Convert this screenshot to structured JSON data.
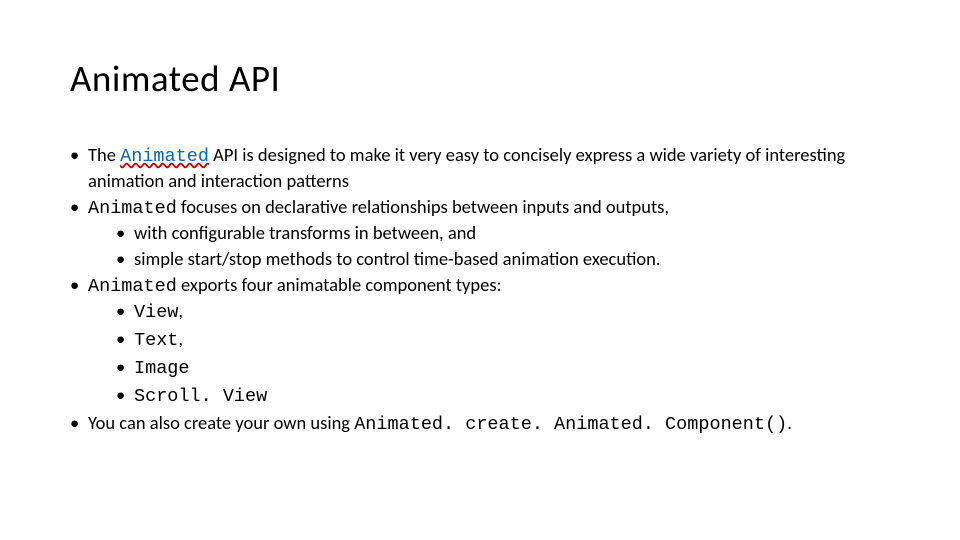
{
  "title": "Animated API",
  "content": {
    "b1_pre": "The ",
    "b1_link": "Animated",
    "b1_post": " API is designed to make it very easy to concisely express a wide variety of interesting animation and interaction patterns",
    "b2_code": "Animated",
    "b2_text": " focuses on declarative relationships between inputs and outputs,",
    "b2_sub1": "with configurable transforms in between, and",
    "b2_sub2": "simple start/stop methods to control time-based animation execution.",
    "b3_code": "Animated",
    "b3_text": " exports four animatable component types:",
    "b3_sub1_code": "View",
    "b3_sub1_comma": ",",
    "b3_sub2_code": "Text",
    "b3_sub2_comma": ",",
    "b3_sub3_code": "Image",
    "b3_sub4_code": "Scroll. View",
    "b4_text": "You can also create your own using ",
    "b4_code": "Animated. create. Animated. Component()",
    "b4_period": "."
  }
}
